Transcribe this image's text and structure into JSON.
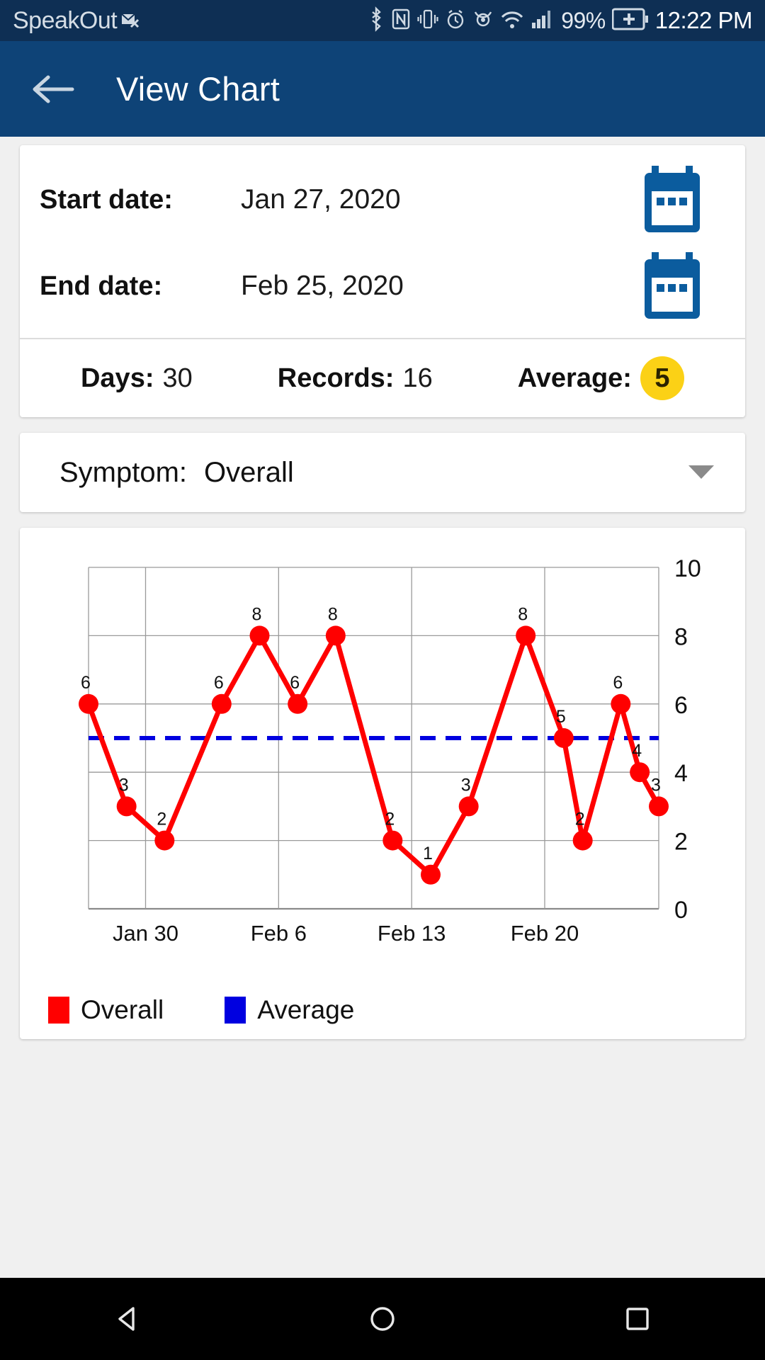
{
  "status_bar": {
    "carrier": "SpeakOut",
    "carrier_icon": "message-badge-icon",
    "icons": [
      "bluetooth-icon",
      "nfc-icon",
      "vibrate-icon",
      "alarm-icon",
      "eye-care-icon",
      "wifi-icon",
      "signal-bars-icon"
    ],
    "battery_percent": "99%",
    "battery_icon": "battery-charging-icon",
    "time": "12:22 PM"
  },
  "app_bar": {
    "back_icon": "arrow-left-icon",
    "title": "View Chart"
  },
  "summary": {
    "start_label": "Start date:",
    "start_value": "Jan 27, 2020",
    "start_icon": "calendar-icon",
    "end_label": "End date:",
    "end_value": "Feb 25, 2020",
    "end_icon": "calendar-icon",
    "days_label": "Days:",
    "days_value": "30",
    "records_label": "Records:",
    "records_value": "16",
    "average_label": "Average:",
    "average_value": "5",
    "average_badge_color": "#fbd116"
  },
  "symptom": {
    "label": "Symptom:",
    "value": "Overall",
    "caret_icon": "chevron-down-icon"
  },
  "chart_data": {
    "type": "line",
    "title": "",
    "xlabel": "",
    "ylabel": "",
    "ylim": [
      0,
      10
    ],
    "yticks": [
      0,
      2,
      4,
      6,
      8,
      10
    ],
    "yticklabels": [
      "0",
      "2",
      "4",
      "6",
      "8",
      "10"
    ],
    "y_axis_position": "right",
    "grid": true,
    "xticks": [
      "Jan 30",
      "Feb 6",
      "Feb 13",
      "Feb 20"
    ],
    "xtick_positions": [
      3,
      10,
      17,
      24
    ],
    "xlim": [
      0,
      30
    ],
    "series": [
      {
        "name": "Overall",
        "color": "#ff0000",
        "style": "line-markers",
        "x": [
          0,
          2,
          4,
          7,
          9,
          11,
          13,
          16,
          18,
          20,
          23,
          25,
          26,
          28,
          29,
          30
        ],
        "values": [
          6,
          3,
          2,
          6,
          8,
          6,
          8,
          2,
          1,
          3,
          8,
          5,
          2,
          6,
          4,
          3
        ],
        "point_labels": [
          "6",
          "3",
          "2",
          "6",
          "8",
          "6",
          "8",
          "2",
          "1",
          "3",
          "8",
          "5",
          "2",
          "6",
          "4",
          "3"
        ]
      },
      {
        "name": "Average",
        "color": "#0000e0",
        "style": "dashed-horizontal",
        "value": 5
      }
    ],
    "legend": [
      {
        "label": "Overall",
        "color": "#ff0000"
      },
      {
        "label": "Average",
        "color": "#0000e0"
      }
    ],
    "legend_position": "bottom-left"
  },
  "nav_bar": {
    "back_icon": "triangle-back-icon",
    "home_icon": "circle-home-icon",
    "recents_icon": "square-recents-icon"
  }
}
